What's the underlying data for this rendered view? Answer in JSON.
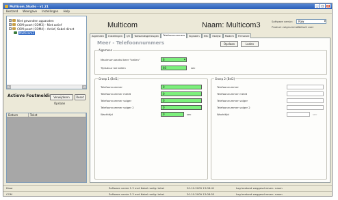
{
  "window": {
    "title": "Multicom_Studio - v1.21"
  },
  "menu": [
    "Bestand",
    "Weergave",
    "Instellingen",
    "Help"
  ],
  "tree": [
    {
      "label": "Niet gevonden apparaten",
      "level": 1
    },
    {
      "label": "COM-poort (COM3) - Niet actief",
      "level": 1
    },
    {
      "label": "COM-poort (COM4) - Actief, Kabel direct",
      "level": 1
    },
    {
      "label": "Multicom3",
      "level": 2,
      "selected": true
    }
  ],
  "actions": {
    "title": "Actieve Foutmeldingen",
    "btn_verwijderen": "Verwijderen",
    "btn_reset": "Reset",
    "btn_opslaan": "Opslaan",
    "col_datum": "Datum",
    "col_tekst": "Tekst"
  },
  "header": {
    "device_name": "Multicom",
    "naam_label": "Naam:",
    "naam_value": "Multicom3",
    "software_label": "Software versie:",
    "software_value": "Raw",
    "product_label": "Product volgnummer:",
    "product_value": "Default user"
  },
  "tabs": [
    "Algemeen",
    "Instellingen",
    "I/O",
    "Toestandsgeheugen",
    "Telefoonnummers",
    "Signalen",
    "IMC",
    "Faxlijst",
    "Modem",
    "Firmware"
  ],
  "active_tab": 4,
  "page_title": "Meer - Telefoonnummers",
  "buttons": {
    "opslaan": "Opslaan",
    "laden": "Laden"
  },
  "algemeen": {
    "title": "Algemeen",
    "field1_label": "Maximum aantal keer \"bellen\"",
    "field1_value": "6",
    "field2_label": "Tijdsduur tot bellen",
    "field2_value": "60",
    "field2_unit": "sec"
  },
  "group1": {
    "title": "Groep 1 (Bel1)",
    "rows": [
      {
        "label": "Telefoonnummer",
        "value": "0"
      },
      {
        "label": "Telefoonnummer meldt",
        "value": "0"
      },
      {
        "label": "Telefoonnummer volger",
        "value": "0"
      },
      {
        "label": "Telefoonnummer volger 2",
        "value": "0"
      },
      {
        "label": "Wachttijd",
        "value": "0",
        "unit": "sec"
      }
    ]
  },
  "group2": {
    "title": "Groep 2 (Bel2)",
    "rows": [
      {
        "label": "Telefoonnummer"
      },
      {
        "label": "Telefoonnummer meldt"
      },
      {
        "label": "Telefoonnummer volger"
      },
      {
        "label": "Telefoonnummer volger 2"
      },
      {
        "label": "Wachttijd",
        "unit": "sec"
      }
    ]
  },
  "statusbar": [
    {
      "c1": "Klaar",
      "c2": "Software versie 1.3 met Kabel nodig: tekst",
      "c3": "20-10-2009 13:08:41",
      "c4": "Log bestand weggeschreven: naam"
    },
    {
      "c1": "COM",
      "c2": "Software versie 1.3 met Kabel nodig: tekst",
      "c3": "20-10-2009 13:08:55",
      "c4": "Log bestand weggeschreven: naam"
    }
  ],
  "colors": {
    "green_field": "#7cf07c",
    "title_blue": "#2c5fb8",
    "bg": "#ece9d8"
  }
}
